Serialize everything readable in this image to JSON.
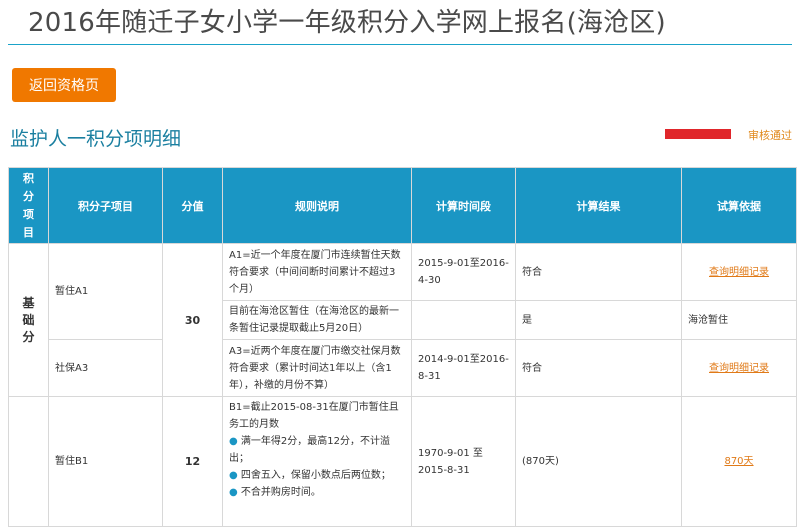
{
  "header": {
    "title": "2016年随迁子女小学一年级积分入学网上报名(海沧区)"
  },
  "back_button": "返回资格页",
  "section": {
    "title": "监护人一积分项明细",
    "status": "审核通过"
  },
  "table": {
    "columns": [
      "积分项目",
      "积分子项目",
      "分值",
      "规则说明",
      "计算时间段",
      "计算结果",
      "试算依据"
    ],
    "groups": [
      {
        "category": "基础分",
        "score": "30"
      },
      {
        "category": "",
        "score": "12"
      }
    ],
    "rows": [
      {
        "subitem": "暂住A1",
        "rule": "A1=近一个年度在厦门市连续暂住天数符合要求（中间间断时间累计不超过3个月）",
        "period": "2015-9-01至2016-4-30",
        "result": "符合",
        "basis": "查询明细记录"
      },
      {
        "rule": "目前在海沧区暂住（在海沧区的最新一条暂住记录提取截止5月20日）",
        "period": "",
        "result": "是",
        "basis": "海沧暂住"
      },
      {
        "subitem": "社保A3",
        "rule": "A3=近两个年度在厦门市缴交社保月数符合要求（累计时间达1年以上（含1年），补缴的月份不算）",
        "period": "2014-9-01至2016-8-31",
        "result": "符合",
        "basis": "查询明细记录"
      },
      {
        "subitem": "暂住B1",
        "rule": "B1=截止2015-08-31在厦门市暂住且务工的月数",
        "bullets": [
          "满一年得2分，最高12分，不计溢出；",
          "四舍五入，保留小数点后两位数；",
          "不合并购房时间。"
        ],
        "period": "1970-9-01 至 2015-8-31",
        "result": "(870天)",
        "basis": "870天"
      }
    ]
  },
  "colors": {
    "accent": "#1a96c4",
    "orange": "#f07800",
    "link": "#e07a18"
  }
}
